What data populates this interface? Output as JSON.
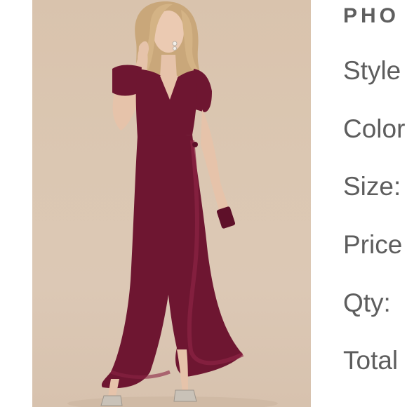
{
  "product_details": {
    "heading": "PHO",
    "fields": {
      "style": "Style",
      "color": "Color",
      "size": "Size:",
      "price": "Price",
      "qty": "Qty:",
      "total": "Total"
    }
  },
  "colors": {
    "dress": "#6e1631",
    "backdrop": "#dac5b0"
  }
}
